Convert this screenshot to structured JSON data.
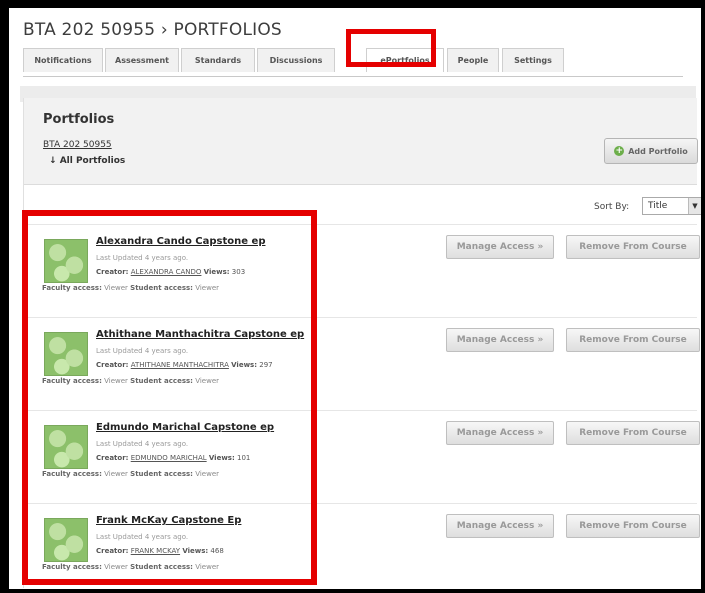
{
  "course_title": "BTA 202 50955 › PORTFOLIOS",
  "tabs": [
    {
      "label": "Notifications"
    },
    {
      "label": "Assessment"
    },
    {
      "label": "Standards"
    },
    {
      "label": "Discussions"
    },
    {
      "label": "ePortfolios"
    },
    {
      "label": "People"
    },
    {
      "label": "Settings"
    }
  ],
  "active_tab": "ePortfolios",
  "section": {
    "title": "Portfolios",
    "breadcrumb_link": "BTA 202 50955",
    "breadcrumb_current": "All Portfolios",
    "add_button": "Add Portfolio"
  },
  "sort": {
    "label": "Sort By:",
    "selected": "Title"
  },
  "labels": {
    "creator": "Creator:",
    "views": "Views:",
    "faculty_access": "Faculty access:",
    "student_access": "Student access:",
    "manage_access": "Manage Access »",
    "remove": "Remove From Course"
  },
  "portfolios": [
    {
      "title": "Alexandra Cando Capstone ep",
      "updated": "Last Updated 4 years ago.",
      "creator": "ALEXANDRA CANDO",
      "views": "303",
      "faculty": "Viewer",
      "student": "Viewer"
    },
    {
      "title": "Athithane Manthachitra Capstone ep",
      "updated": "Last Updated 4 years ago.",
      "creator": "ATHITHANE MANTHACHITRA",
      "views": "297",
      "faculty": "Viewer",
      "student": "Viewer"
    },
    {
      "title": "Edmundo Marichal Capstone ep",
      "updated": "Last Updated 4 years ago.",
      "creator": "EDMUNDO MARICHAL",
      "views": "101",
      "faculty": "Viewer",
      "student": "Viewer"
    },
    {
      "title": "Frank McKay Capstone Ep",
      "updated": "Last Updated 4 years ago.",
      "creator": "FRANK MCKAY",
      "views": "468",
      "faculty": "Viewer",
      "student": "Viewer"
    }
  ],
  "colors": {
    "highlight": "#e50000",
    "header_bg": "#f2f2f2",
    "add_icon": "#6cae4a"
  }
}
